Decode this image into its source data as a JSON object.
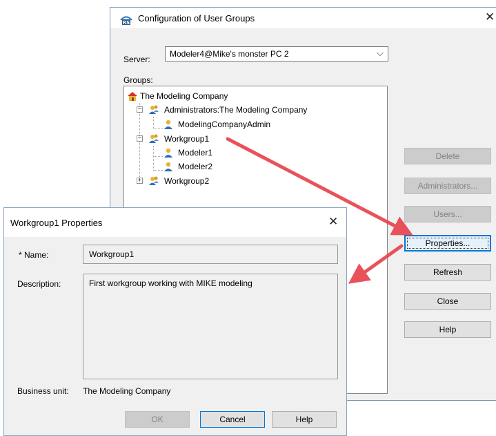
{
  "config_dialog": {
    "title": "Configuration of User Groups",
    "server_label": "Server:",
    "server_value": "Modeler4@Mike's monster PC 2",
    "groups_label": "Groups:",
    "tree": {
      "root": "The Modeling Company",
      "admin_group": "Administrators:The Modeling Company",
      "admin_user": "ModelingCompanyAdmin",
      "workgroup1": "Workgroup1",
      "modeler1": "Modeler1",
      "modeler2": "Modeler2",
      "workgroup2": "Workgroup2"
    },
    "buttons": {
      "delete": "Delete",
      "administrators": "Administrators...",
      "users": "Users...",
      "properties": "Properties...",
      "refresh": "Refresh",
      "close": "Close",
      "help": "Help"
    }
  },
  "props_dialog": {
    "title": "Workgroup1 Properties",
    "name_label": "* Name:",
    "name_value": "Workgroup1",
    "description_label": "Description:",
    "description_value": "First workgroup working with MIKE modeling",
    "business_unit_label": "Business unit:",
    "business_unit_value": "The Modeling Company",
    "buttons": {
      "ok": "OK",
      "cancel": "Cancel",
      "help": "Help"
    }
  },
  "colors": {
    "arrow": "#e8404a",
    "focus": "#0078d7"
  },
  "icons": [
    "app-icon",
    "house-icon",
    "group-icon",
    "user-icon",
    "close-icon",
    "chevron-down-icon"
  ]
}
